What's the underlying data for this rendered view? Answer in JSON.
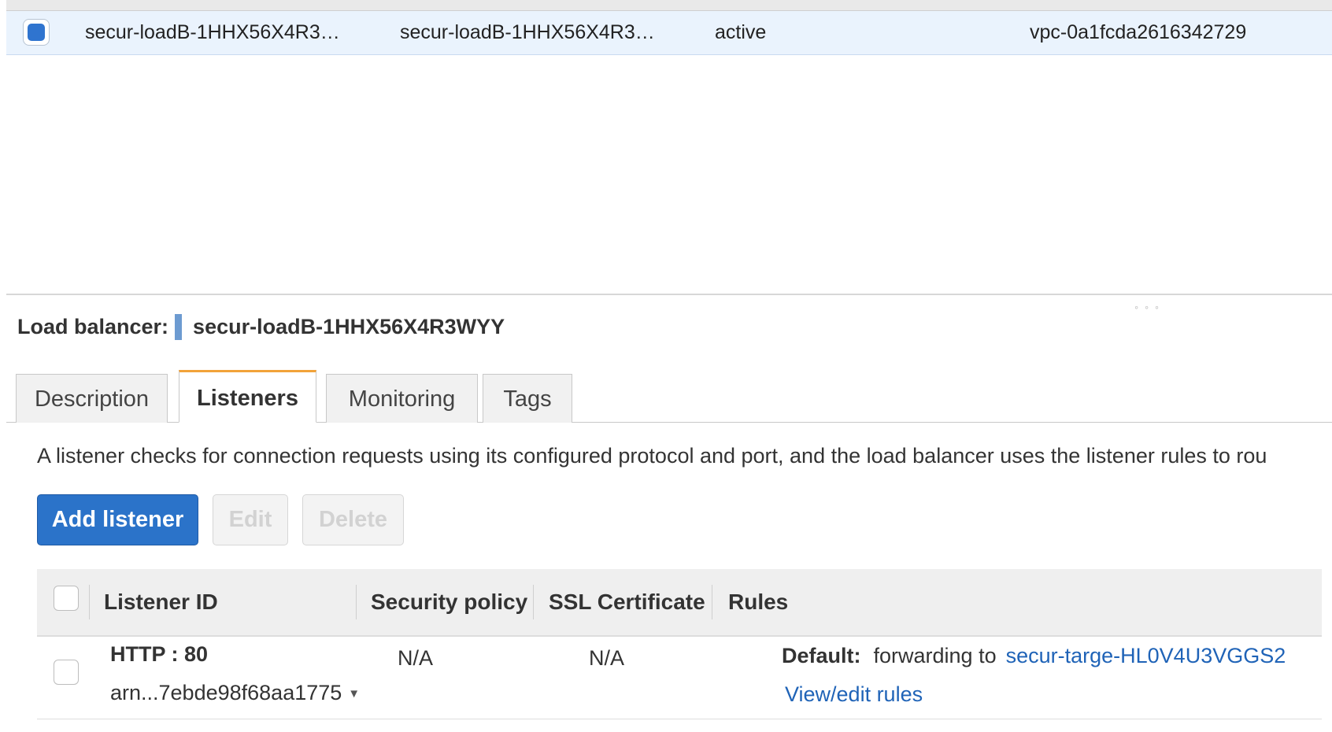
{
  "load_balancer_list": {
    "selected_row": {
      "name": "secur-loadB-1HHX56X4R3…",
      "dns_name": "secur-loadB-1HHX56X4R3…",
      "state": "active",
      "vpc_id": "vpc-0a1fcda2616342729"
    }
  },
  "details": {
    "title_label": "Load balancer:",
    "title_value": "secur-loadB-1HHX56X4R3WYY",
    "tabs": [
      {
        "label": "Description"
      },
      {
        "label": "Listeners"
      },
      {
        "label": "Monitoring"
      },
      {
        "label": "Tags"
      }
    ],
    "active_tab": "Listeners"
  },
  "listeners": {
    "intro": "A listener checks for connection requests using its configured protocol and port, and the load balancer uses the listener rules to rou",
    "buttons": {
      "add": "Add listener",
      "edit": "Edit",
      "delete": "Delete"
    },
    "columns": [
      "Listener ID",
      "Security policy",
      "SSL Certificate",
      "Rules"
    ],
    "rows": [
      {
        "protocol_port": "HTTP : 80",
        "arn": "arn...7ebde98f68aa1775",
        "security_policy": "N/A",
        "ssl_certificate": "N/A",
        "rules_default_label": "Default:",
        "rules_action": "forwarding to",
        "rules_target": "secur-targe-HL0V4U3VGGS2",
        "rules_link": "View/edit rules"
      }
    ]
  },
  "colors": {
    "accent_blue": "#2b73c9",
    "link_blue": "#1f63b7",
    "active_tab_border": "#f2a33a",
    "selected_row_bg": "#eaf3fd"
  }
}
